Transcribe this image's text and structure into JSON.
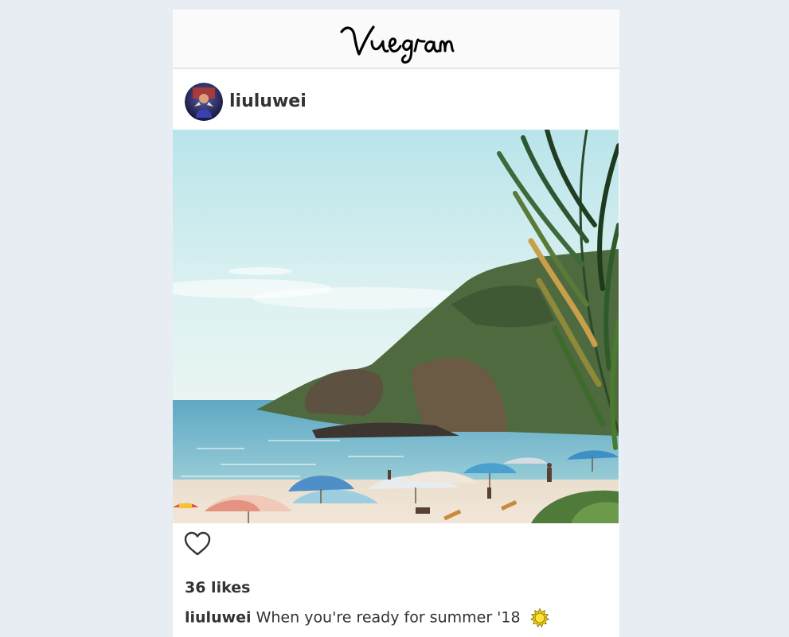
{
  "app": {
    "logo_text": "Vuegram"
  },
  "post": {
    "username": "liuluwei",
    "likes_text": "36 likes",
    "caption_user": "liuluwei",
    "caption_text": "When you're ready for summer '18",
    "liked": false
  },
  "icons": {
    "avatar": "avatar",
    "like": "heart-outline-icon",
    "emoji": "sun-emoji-icon"
  },
  "colors": {
    "page_bg": "#e8edf3",
    "text": "#333333",
    "header_bg": "#fafafa",
    "sun_yellow": "#f5d20a"
  }
}
